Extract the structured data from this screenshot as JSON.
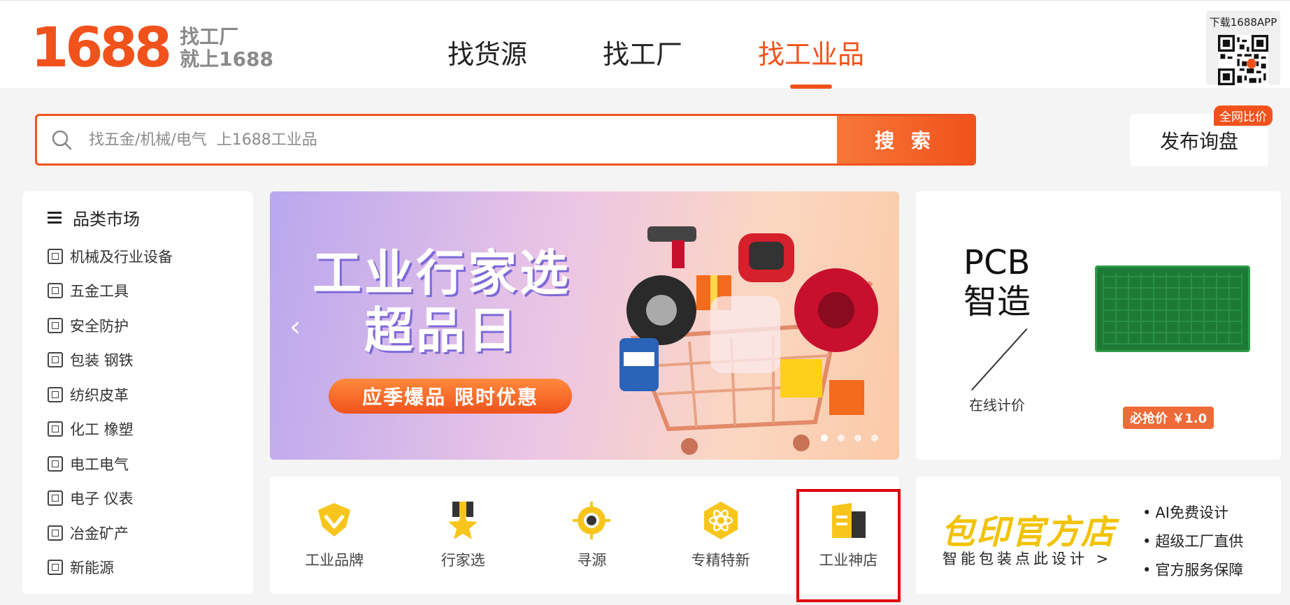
{
  "header": {
    "logo": "1688",
    "slogan_line1": "找工厂",
    "slogan_line2": "就上1688",
    "nav": [
      {
        "label": "找货源",
        "active": false
      },
      {
        "label": "找工厂",
        "active": false
      },
      {
        "label": "找工业品",
        "active": true
      }
    ],
    "app_download": "下载1688APP"
  },
  "search": {
    "placeholder": "找五金/机械/电气  上1688工业品",
    "button": "搜 索"
  },
  "inquiry": {
    "label": "发布询盘",
    "badge": "全网比价"
  },
  "sidebar": {
    "title": "品类市场",
    "items": [
      {
        "label": "机械及行业设备",
        "icon": "machine-icon"
      },
      {
        "label": "五金工具",
        "icon": "hardware-icon"
      },
      {
        "label": "安全防护",
        "icon": "safety-icon"
      },
      {
        "label": "包装  钢铁",
        "icon": "package-icon"
      },
      {
        "label": "纺织皮革",
        "icon": "textile-icon"
      },
      {
        "label": "化工  橡塑",
        "icon": "chemical-icon"
      },
      {
        "label": "电工电气",
        "icon": "electric-icon"
      },
      {
        "label": "电子  仪表",
        "icon": "chip-icon"
      },
      {
        "label": "冶金矿产",
        "icon": "mining-icon"
      },
      {
        "label": "新能源",
        "icon": "energy-icon"
      }
    ]
  },
  "banner": {
    "title_line1": "工业行家选",
    "title_line2": "超品日",
    "pill": "应季爆品  限时优惠",
    "slide_count": 4,
    "active_slide": 1
  },
  "pcb": {
    "title_line1": "PCB",
    "title_line2": "智造",
    "subtitle": "在线计价",
    "price_tag": "必抢价 ￥1.0"
  },
  "quick_links": [
    {
      "label": "工业品牌",
      "icon": "brand-badge-icon"
    },
    {
      "label": "行家选",
      "icon": "star-medal-icon"
    },
    {
      "label": "寻源",
      "icon": "target-icon"
    },
    {
      "label": "专精特新",
      "icon": "atom-icon"
    },
    {
      "label": "工业神店",
      "icon": "shop-icon",
      "highlighted": true
    }
  ],
  "packaging": {
    "title": "包印官方店",
    "subtitle": "智能包装点此设计 >",
    "features": [
      "AI免费设计",
      "超级工厂直供",
      "官方服务保障"
    ]
  },
  "colors": {
    "brand": "#f1521c",
    "highlight_box": "#e00000",
    "pack_title": "#f2c200"
  }
}
